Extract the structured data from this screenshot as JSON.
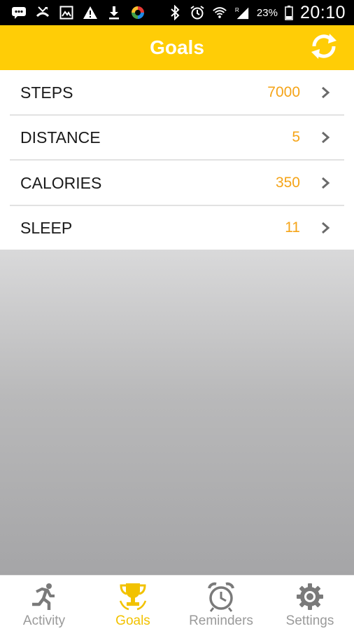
{
  "status_bar": {
    "battery_percent": "23%",
    "time": "20:10",
    "left_icons": [
      "message-icon",
      "missed-call-icon",
      "image-icon",
      "warning-icon",
      "download-icon",
      "google-photos-icon"
    ],
    "right_icons": [
      "bluetooth-icon",
      "alarm-icon",
      "wifi-icon",
      "signal-icon",
      "battery-icon"
    ]
  },
  "header": {
    "title": "Goals",
    "action_icon": "sync-icon",
    "background_color": "#ffcd06"
  },
  "goals": [
    {
      "label": "STEPS",
      "value": "7000"
    },
    {
      "label": "DISTANCE",
      "value": "5"
    },
    {
      "label": "CALORIES",
      "value": "350"
    },
    {
      "label": "SLEEP",
      "value": "11"
    }
  ],
  "colors": {
    "accent": "#ffcd06",
    "value_text": "#f5a418",
    "inactive_nav": "#9a9a9a",
    "active_nav": "#f2c200"
  },
  "bottom_nav": {
    "items": [
      {
        "label": "Activity",
        "icon": "running-person-icon",
        "active": false
      },
      {
        "label": "Goals",
        "icon": "trophy-icon",
        "active": true
      },
      {
        "label": "Reminders",
        "icon": "alarm-clock-icon",
        "active": false
      },
      {
        "label": "Settings",
        "icon": "gear-icon",
        "active": false
      }
    ]
  }
}
